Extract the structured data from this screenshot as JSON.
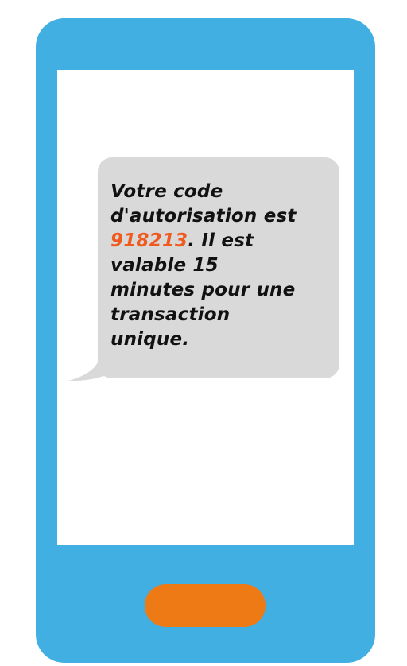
{
  "sms": {
    "line1": "Votre code",
    "line2": "d'autorisation est",
    "code": "918213",
    "line3_rest": ". Il est",
    "line4": "valable 15",
    "line5": "minutes pour une",
    "line6": "transaction",
    "line7": "unique."
  },
  "colors": {
    "phone_body": "#41afe1",
    "screen": "#ffffff",
    "bubble": "#d9d9d9",
    "code": "#f05a1e",
    "home_button": "#ee7a16"
  },
  "icons": {
    "home_button": "home-button-pill"
  }
}
